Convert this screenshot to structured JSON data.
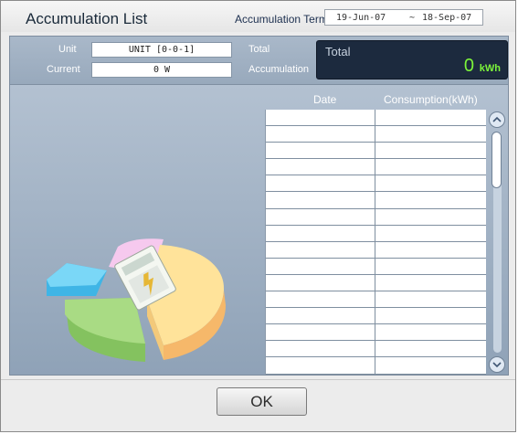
{
  "window": {
    "title": "Accumulation List",
    "term_label": "Accumulation Term",
    "term_start": "19-Jun-07",
    "term_separator": "~",
    "term_end": "18-Sep-07"
  },
  "info": {
    "unit_label": "Unit",
    "unit_value": "UNIT [0-0-1]",
    "current_label": "Current",
    "current_value": "0 W",
    "total_label_line1": "Total",
    "total_label_line2": "Accumulation",
    "total_box_label": "Total",
    "total_value": "0",
    "total_unit": "kWh"
  },
  "table": {
    "col_date": "Date",
    "col_consumption": "Consumption(kWh)",
    "row_count": 16,
    "rows": []
  },
  "colors": {
    "panel": "#9fb0c3",
    "total_bg": "#1c2a3e",
    "total_value": "#7cf43a"
  },
  "icons": [
    "pie-chart-icon",
    "scroll-up-icon",
    "scroll-down-icon"
  ],
  "buttons": {
    "ok": "OK"
  }
}
